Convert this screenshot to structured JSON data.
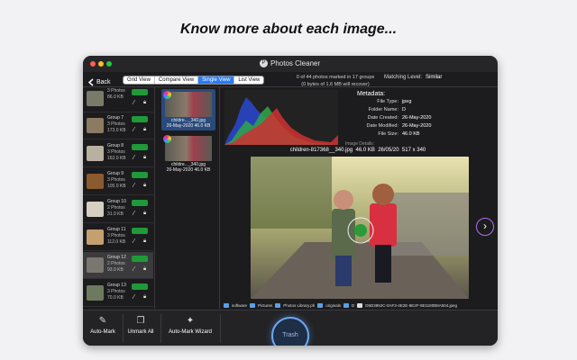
{
  "headline": "Know more about each image...",
  "window": {
    "title": "Photos Cleaner",
    "logo_letter": "P",
    "back_label": "Back",
    "views": [
      "Grid View",
      "Compare View",
      "Single View",
      "List View"
    ],
    "active_view": "Single View",
    "marked_line1": "0 of 44 photos marked in 17 groups",
    "marked_line2": "(0 bytes of 1.6 MB will recover)",
    "matching_label": "Matching Level:",
    "matching_value": "Similar"
  },
  "groups": [
    {
      "name": "",
      "count": "3 Photos",
      "size": "86.0 KB",
      "thumb_color": "#7a7a68"
    },
    {
      "name": "Group 7",
      "count": "3 Photos",
      "size": "173.0 KB",
      "thumb_color": "#8b7b62"
    },
    {
      "name": "Group 8",
      "count": "3 Photos",
      "size": "163.0 KB",
      "thumb_color": "#b8b0a0"
    },
    {
      "name": "Group 9",
      "count": "3 Photos",
      "size": "105.0 KB",
      "thumb_color": "#8b5a2e"
    },
    {
      "name": "Group 10",
      "count": "2 Photos",
      "size": "31.0 KB",
      "thumb_color": "#d6cfc2"
    },
    {
      "name": "Group 11",
      "count": "3 Photos",
      "size": "112.0 KB",
      "thumb_color": "#c4a070"
    },
    {
      "name": "Group 12",
      "count": "2 Photos",
      "size": "93.0 KB",
      "thumb_color": "#7a7670"
    },
    {
      "name": "Group 13",
      "count": "3 Photos",
      "size": "70.0 KB",
      "thumb_color": "#6e7a5e"
    }
  ],
  "photos": [
    {
      "name": "childre..._340.jpg",
      "date": "26-May-2020",
      "size": "46.0 KB"
    },
    {
      "name": "childre..._340.jpg",
      "date": "26-May-2020",
      "size": "46.0 KB"
    }
  ],
  "metadata": {
    "title": "Metadata:",
    "rows": [
      {
        "key": "File Type:",
        "value": "jpeg"
      },
      {
        "key": "Folder Name:",
        "value": "D"
      },
      {
        "key": "Date Created:",
        "value": "26-May-2020"
      },
      {
        "key": "Date Modified:",
        "value": "26-May-2020"
      },
      {
        "key": "File Size:",
        "value": "46.0 KB"
      }
    ],
    "details_label": "Image Details:"
  },
  "image_header": {
    "name": "children-817368__340.jpg",
    "size": "46.0 KB",
    "date": "26/05/20",
    "dims": "517 x 340"
  },
  "path": [
    "software",
    "Pictures",
    "Photos Library.ph",
    "originals",
    "D",
    "D5D3952C-0AF3-4E2E-8E2F-9E1180B8A504.jpeg"
  ],
  "bottom": {
    "auto_mark": "Auto-Mark",
    "unmark_all": "Unmark All",
    "auto_mark_wizard": "Auto-Mark Wizard",
    "trash": "Trash"
  },
  "colors": {
    "accent": "#2b7cf6",
    "badge": "#1f9a3a",
    "next_ring": "#b06cf0",
    "trash_ring": "#6aa8f0"
  }
}
